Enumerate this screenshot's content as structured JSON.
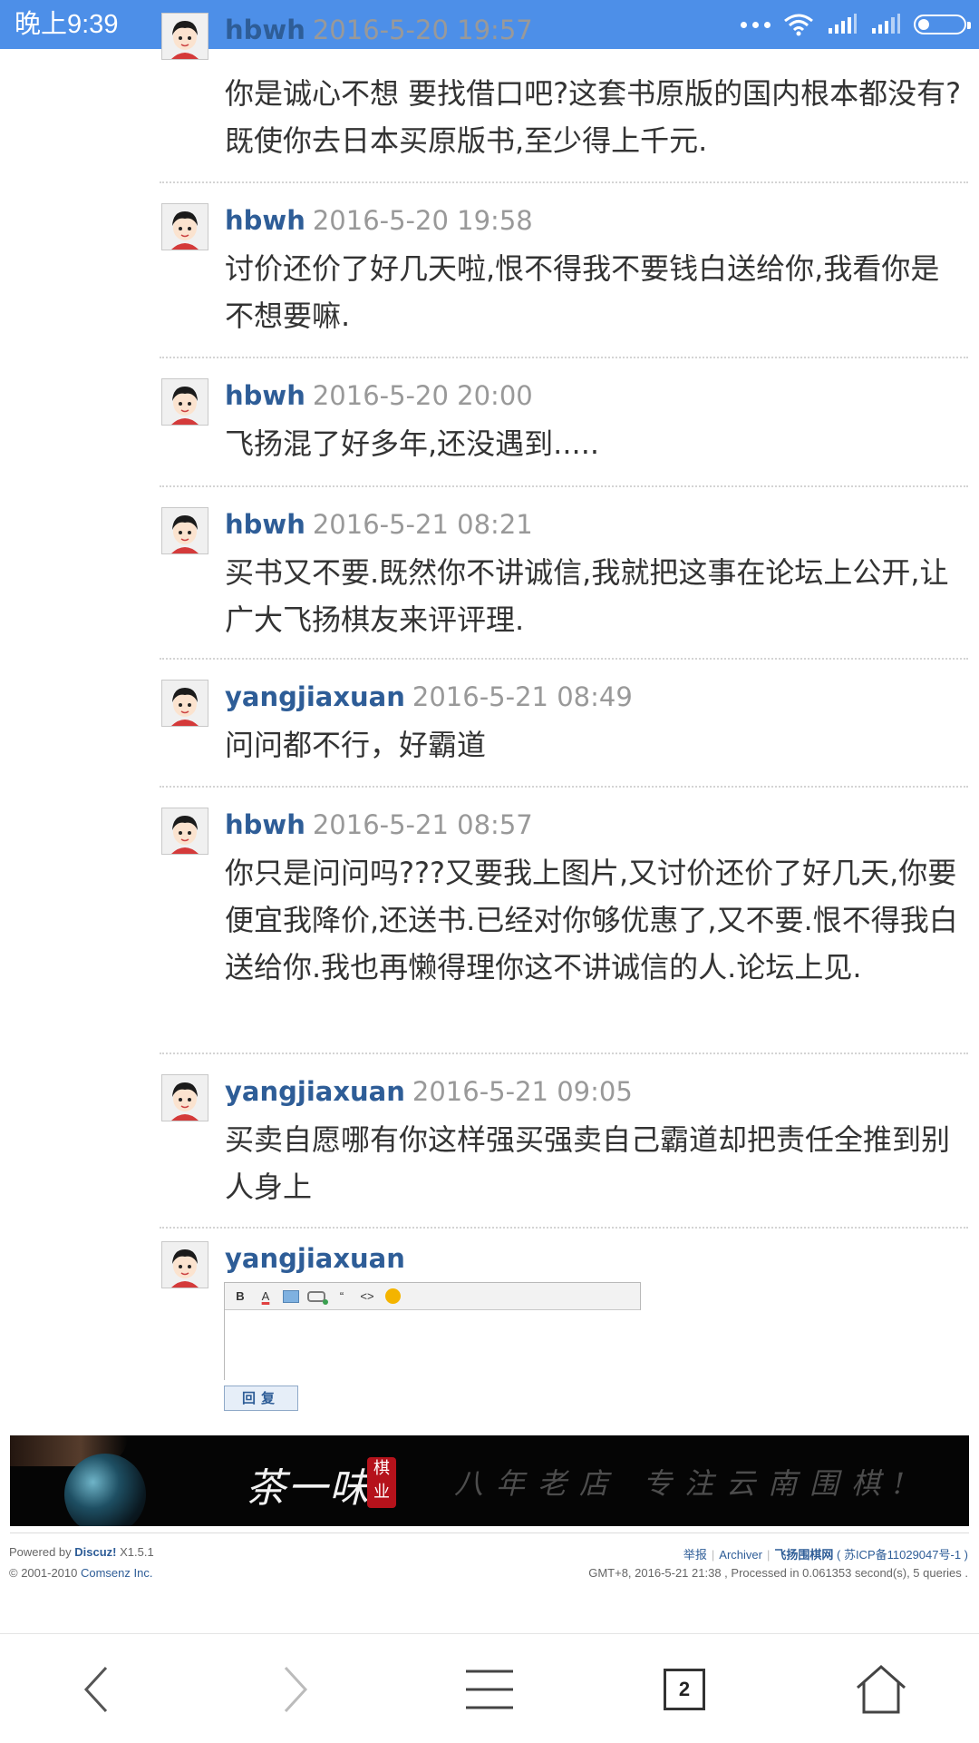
{
  "status_bar": {
    "time": "晚上9:39",
    "icons": [
      "more-dots-icon",
      "wifi-icon",
      "signal-icon",
      "signal-icon",
      "battery-icon"
    ]
  },
  "posts": [
    {
      "user": "hbwh",
      "date": "2016-5-20 19:57",
      "message": "你是诚心不想 要找借口吧?这套书原版的国内根本都没有?既使你去日本买原版书,至少得上千元."
    },
    {
      "user": "hbwh",
      "date": "2016-5-20 19:58",
      "message": "讨价还价了好几天啦,恨不得我不要钱白送给你,我看你是不想要嘛."
    },
    {
      "user": "hbwh",
      "date": "2016-5-20 20:00",
      "message": "飞扬混了好多年,还没遇到....."
    },
    {
      "user": "hbwh",
      "date": "2016-5-21 08:21",
      "message": "买书又不要.既然你不讲诚信,我就把这事在论坛上公开,让广大飞扬棋友来评评理."
    },
    {
      "user": "yangjiaxuan",
      "date": "2016-5-21 08:49",
      "message": "问问都不行，好霸道"
    },
    {
      "user": "hbwh",
      "date": "2016-5-21 08:57",
      "message": "你只是问问吗???又要我上图片,又讨价还价了好几天,你要便宜我降价,还送书.已经对你够优惠了,又不要.恨不得我白送给你.我也再懒得理你这不讲诚信的人.论坛上见."
    },
    {
      "user": "yangjiaxuan",
      "date": "2016-5-21 09:05",
      "message": "买卖自愿哪有你这样强买强卖自己霸道却把责任全推到别人身上"
    }
  ],
  "reply": {
    "user": "yangjiaxuan",
    "toolbar": [
      "bold-icon",
      "font-color-icon",
      "image-icon",
      "link-icon",
      "quote-icon",
      "code-icon",
      "smiley-icon"
    ],
    "toolbar_text": {
      "bold": "B",
      "font_color": "A",
      "quote": "“",
      "code": "<>"
    },
    "button_label": "回复"
  },
  "banner": {
    "brand": "茶一味",
    "registered": "®",
    "seal": "棋业",
    "slogan": "八年老店 专注云南围棋!"
  },
  "footer": {
    "powered_prefix": "Powered by",
    "powered_name": "Discuz!",
    "powered_version": "X1.5.1",
    "copyright_prefix": "© 2001-2010",
    "copyright_company": "Comsenz Inc.",
    "links": [
      "举报",
      "Archiver"
    ],
    "site_name": "飞扬围棋网",
    "icp": "( 苏ICP备11029047号-1 )",
    "stats": "GMT+8, 2016-5-21 21:38 , Processed in 0.061353 second(s), 5 queries ."
  },
  "nav": {
    "tab_count": "2",
    "icons": [
      "back-icon",
      "forward-icon",
      "menu-icon",
      "tabs-icon",
      "home-icon"
    ]
  }
}
